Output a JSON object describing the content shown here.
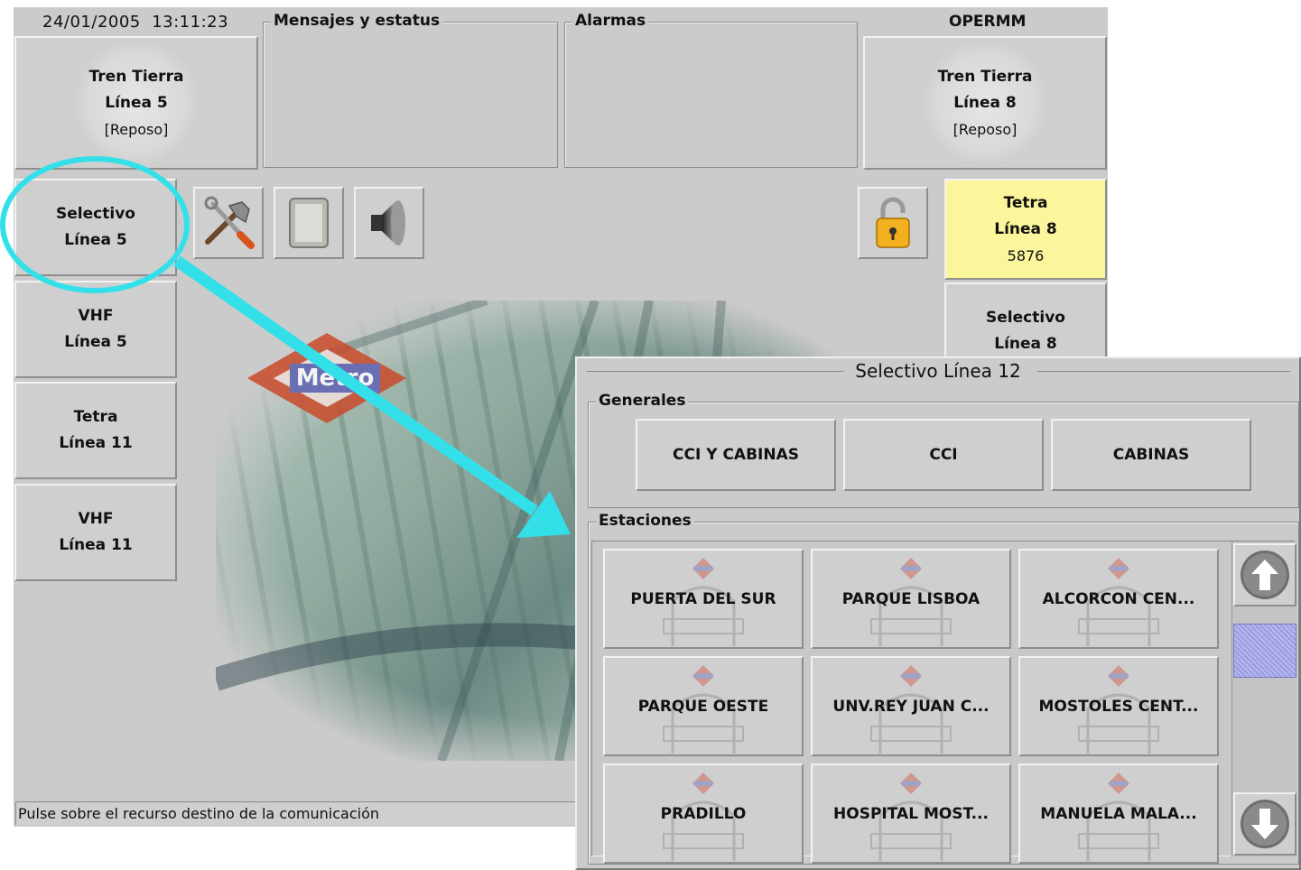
{
  "header": {
    "datetime": "24/01/2005  13:11:23",
    "messages_label": "Mensajes y estatus",
    "alarms_label": "Alarmas",
    "operator": "OPERMM"
  },
  "top_left_resource": {
    "line1": "Tren Tierra",
    "line2": "Línea 5",
    "line3": "[Reposo]"
  },
  "top_right_resource": {
    "line1": "Tren Tierra",
    "line2": "Línea 8",
    "line3": "[Reposo]"
  },
  "left_buttons": [
    {
      "line1": "Selectivo",
      "line2": "Línea 5"
    },
    {
      "line1": "VHF",
      "line2": "Línea 5"
    },
    {
      "line1": "Tetra",
      "line2": "Línea 11"
    },
    {
      "line1": "VHF",
      "line2": "Línea 11"
    }
  ],
  "right_buttons": [
    {
      "line1": "Tetra",
      "line2": "Línea 8",
      "line3": "5876",
      "bg": "#fbf59b"
    },
    {
      "line1": "Selectivo",
      "line2": "Línea 8"
    }
  ],
  "toolbar_icons": [
    "tools-icon",
    "clipboard-icon",
    "speaker-icon",
    "padlock-icon"
  ],
  "logo_text": "Metro",
  "status_message": "Pulse sobre el recurso destino de la comunicación",
  "dialog": {
    "title": "Selectivo Línea 12",
    "generales_label": "Generales",
    "generales": [
      "CCI Y CABINAS",
      "CCI",
      "CABINAS"
    ],
    "estaciones_label": "Estaciones",
    "estaciones": [
      "PUERTA DEL SUR",
      "PARQUE LISBOA",
      "ALCORCON CEN...",
      "PARQUE OESTE",
      "UNV.REY JUAN C...",
      "MOSTOLES CENT...",
      "PRADILLO",
      "HOSPITAL MOST...",
      "MANUELA MALA..."
    ],
    "scroll_position": 0.12
  },
  "colors": {
    "annotation": "#33e0ea",
    "highlight": "#fbf59b",
    "panel": "#cbcbcb"
  }
}
